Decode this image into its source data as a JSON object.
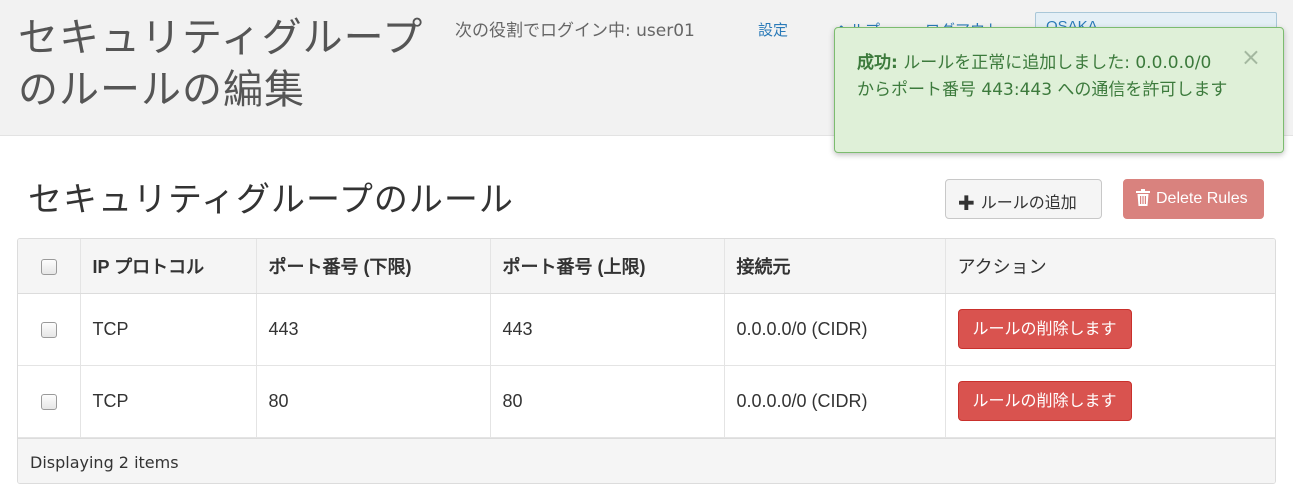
{
  "header": {
    "title": "セキュリティグループのルールの編集",
    "login_prefix": "次の役割でログイン中:",
    "username": "user01",
    "nav": {
      "settings": "設定",
      "help": "ヘルプ",
      "logout": "ログアウト"
    },
    "region": "OSAKA"
  },
  "alert": {
    "label": "成功:",
    "message": "ルールを正常に追加しました: 0.0.0.0/0 からポート番号 443:443 への通信を許可します",
    "close": "×"
  },
  "section": {
    "title": "セキュリティグループのルール",
    "add_button": "ルールの追加",
    "delete_button": "Delete Rules"
  },
  "table": {
    "columns": [
      "IP プロトコル",
      "ポート番号 (下限)",
      "ポート番号 (上限)",
      "接続元",
      "アクション"
    ],
    "rows": [
      {
        "protocol": "TCP",
        "port_min": "443",
        "port_max": "443",
        "source": "0.0.0.0/0 (CIDR)",
        "action": "ルールの削除します"
      },
      {
        "protocol": "TCP",
        "port_min": "80",
        "port_max": "80",
        "source": "0.0.0.0/0 (CIDR)",
        "action": "ルールの削除します"
      }
    ],
    "footer": "Displaying 2 items"
  },
  "colors": {
    "link": "#2a7ab8",
    "success_bg": "#dff0d8",
    "success_text": "#3c7a3c",
    "danger": "#d9534f",
    "danger_disabled": "#d9827e"
  }
}
